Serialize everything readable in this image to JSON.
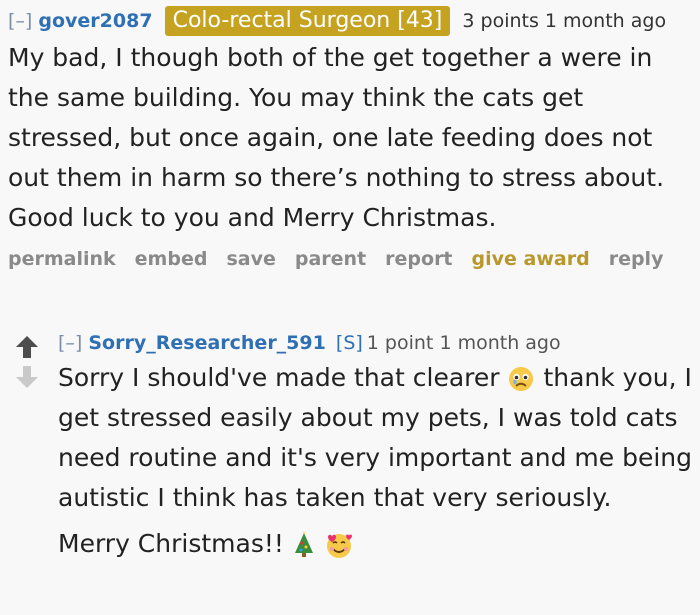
{
  "parent_comment": {
    "collapse": "[–]",
    "author": "gover2087",
    "flair": "Colo-rectal Surgeon [43]",
    "score": "3 points",
    "age": "1 month ago",
    "body": "My bad, I though both of the get together a were in the same building. You may think the cats get stressed, but once again, one late feeding does not out them in harm so there’s nothing to stress about. Good luck to you and Merry Christmas.",
    "buttons": {
      "permalink": "permalink",
      "embed": "embed",
      "save": "save",
      "parent": "parent",
      "report": "report",
      "give_award": "give award",
      "reply": "reply"
    }
  },
  "child_comment": {
    "collapse": "[–]",
    "author": "Sorry_Researcher_591",
    "submitter_tag": "[S]",
    "score": "1 point",
    "age": "1 month ago",
    "body_1a": "Sorry I should've made that clearer",
    "body_1b": "thank you, I get stressed easily about my pets, I was told cats need routine and it's very important and me being autistic I think has taken that very seriously.",
    "body_2": "Merry Christmas!!",
    "emoji_icons": [
      "sad-face-icon",
      "christmas-tree-icon",
      "smiling-face-with-hearts-icon"
    ]
  },
  "colors": {
    "author": "#2f6fb3",
    "flair_bg": "#c5a320",
    "give_award": "#b8982c",
    "buttons": "#8a8a8a"
  }
}
